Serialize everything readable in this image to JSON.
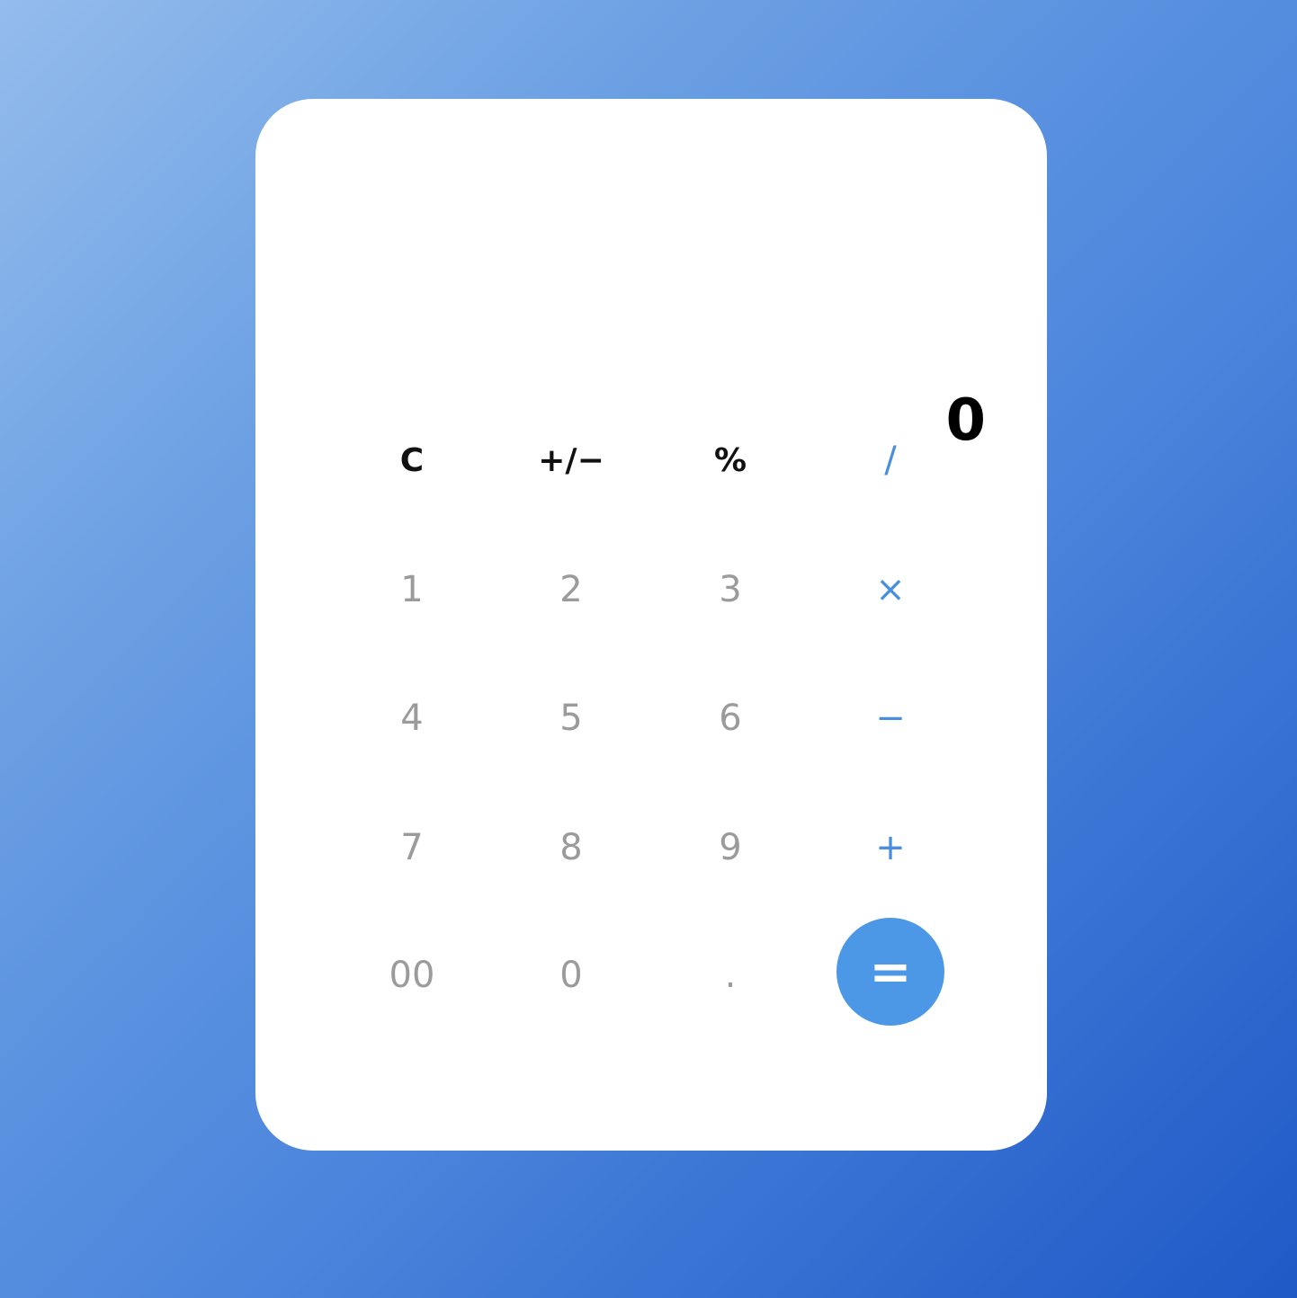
{
  "display": {
    "value": "0"
  },
  "keys": {
    "clear": "C",
    "sign": "+/−",
    "percent": "%",
    "divide": "/",
    "one": "1",
    "two": "2",
    "three": "3",
    "multiply": "×",
    "four": "4",
    "five": "5",
    "six": "6",
    "subtract": "−",
    "seven": "7",
    "eight": "8",
    "nine": "9",
    "add": "+",
    "double_zero": "00",
    "zero": "0",
    "decimal": ".",
    "equals": "="
  },
  "colors": {
    "accent": "#4d98e6",
    "operator": "#4a8fdd",
    "digit": "#9b9b9b",
    "function": "#111111",
    "background_start": "#94bcec",
    "background_end": "#1f59c6"
  }
}
